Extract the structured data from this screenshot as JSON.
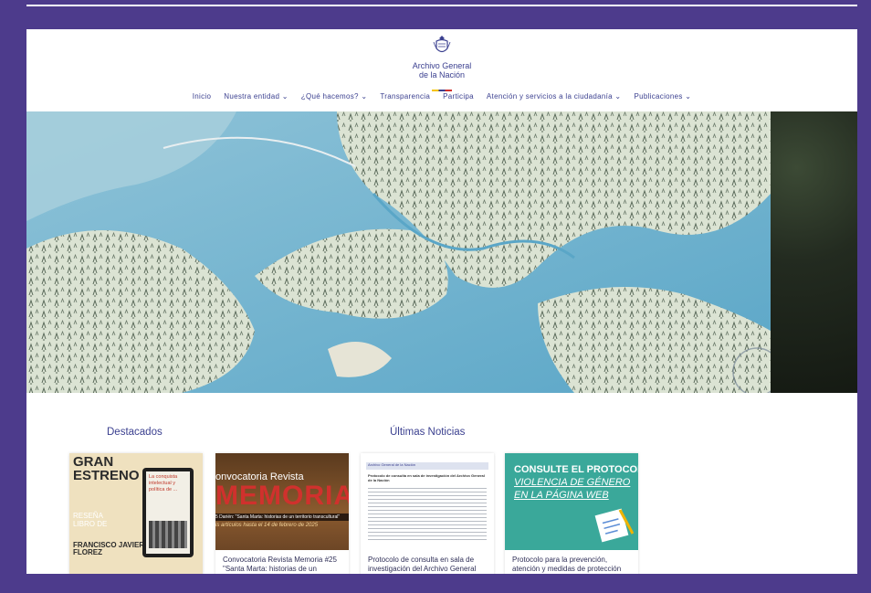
{
  "header": {
    "logo_line1": "Archivo General",
    "logo_line2": "de la Nación"
  },
  "nav": {
    "items": [
      {
        "label": "Inicio"
      },
      {
        "label": "Nuestra entidad ⌄"
      },
      {
        "label": "¿Qué hacemos? ⌄"
      },
      {
        "label": "Transparencia"
      },
      {
        "label": "Participa"
      },
      {
        "label": "Atención y servicios a la ciudadanía ⌄"
      },
      {
        "label": "Publicaciones ⌄"
      }
    ]
  },
  "sections": {
    "featured_title": "Destacados",
    "news_title": "Últimas Noticias"
  },
  "cards": [
    {
      "img_text_1": "GRAN",
      "img_text_2": "ESTRENO",
      "img_text_3": "RESEÑA",
      "img_text_4": "LIBRO DE",
      "img_text_5": "FRANCISCO JAVIER",
      "img_text_6": "FLOREZ",
      "book_title": "La conquista intelectual y política de ...",
      "caption": ""
    },
    {
      "img_text_1": "onvocatoria Revista",
      "img_text_2": "MEMORIA",
      "img_text_3": "5 Darién: \"Santa Marta: historias de un territorio transcultural\"",
      "img_text_4": "is artículos hasta el 14 de febrero de 2025",
      "caption": "Convocatoria Revista Memoria #25 \"Santa Marta: historias de un"
    },
    {
      "img_text_1": "Archivo General de la Nación",
      "img_text_2": "Protocolo de consulta en sala de investigación del Archivo General de la Nación",
      "caption": "Protocolo de consulta en sala de investigación del Archivo General"
    },
    {
      "img_text_1": "CONSULTE EL PROTOCOL",
      "img_text_2": "VIOLENCIA DE GÉNERO",
      "img_text_3": "EN LA PÁGINA WEB",
      "caption": "Protocolo para la prevención, atención y medidas de protección"
    }
  ],
  "colors": {
    "frame": "#4d3b8c",
    "brand_text": "#3a3f8f",
    "teal_card": "#3aa89a",
    "memoria_red": "#d0312d"
  }
}
